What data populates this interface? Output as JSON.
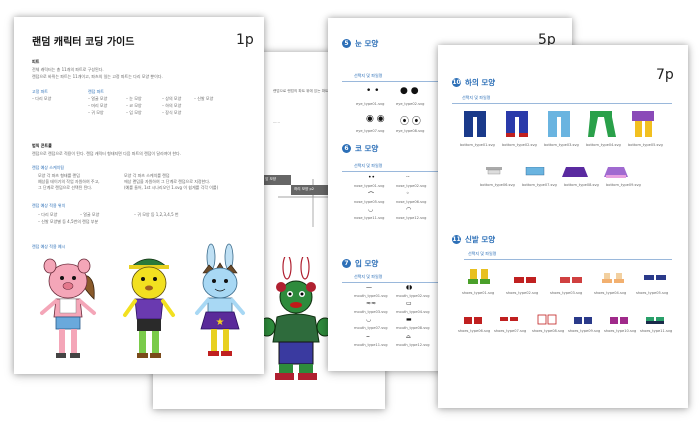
{
  "page1": {
    "title": "랜덤 캐릭터 코딩 가이드",
    "num": "1p",
    "sec1": "피트",
    "sec1_text1": "전체 캐릭터는 총 11개의 파트로 구성된다.",
    "sec1_text2": "랜덤으로 바뀌는 파트는 11개이고, 파츠의 일는 고정 파트는 다리 모양 뿐이다.",
    "list_a": "고정 파트",
    "list_a1": "– 다리 모양",
    "list_b": "랜덤 파트",
    "list_b_items": [
      "– 얼굴 모양",
      "– 눈 모양",
      "– 상의 모양",
      "– 신발 모양",
      "– 머리 모양",
      "– 코 모양",
      "– 하의 모양",
      "– 귀 모양",
      "– 입 모양",
      "– 장식 모양"
    ],
    "sec2": "법칙 콘트롤",
    "sec2_text": "랜덤으로 랜덤으로 적용이 된다. 랜덤 캐릭터 형태지면 다음 파트의 랜덤이 달라져야 한다.",
    "sub1": "랜덤 예상 스케치됨",
    "sub1_l1": "모양 각 파츠 형태를 랜덤",
    "sub1_l2": "예상을 테이기의 작업 자원하여 주고,",
    "sub1_l3": "그 단계로 랜덤으로 선택된 된다.",
    "sub1_r1": "모양 각 파츠 스케치를 랜덤",
    "sub1_r2": "에상 랜덤을 자원하여 그 단계로 랜덤으로 지정한다.",
    "sub1_r3": "(예를 들어, 1st 시나리오인 1.svg 이 쉽게를 각각 이를)",
    "sub2": "랜덤 예상 적용 위치",
    "sub2_row1": [
      "– 다리 모양",
      "– 얼굴 모양",
      "– 귀 모양 등 1,2,3,4,5 번"
    ],
    "sub2_row2": "– 신발 모양별 등 4,5번의 랜덤 부분",
    "sub3": "랜덤 예상 적용 예시"
  },
  "page_mid": {
    "labels": [
      "앞 모양",
      "하리 모양",
      "하리 모양 p2"
    ],
    "text": "랜덤으로 랜덤의 파트 위에 있는 파트"
  },
  "page5": {
    "num": "5p",
    "s5": "눈 모양",
    "s5_badge": "5",
    "s6": "코 모양",
    "s6_badge": "6",
    "s7": "입 모양",
    "s7_badge": "7",
    "sub": "선택지 및 파일명",
    "eyes": [
      "eye_type01.svg",
      "eye_type02.svg",
      "eye_type05.svg",
      "eye_type06.svg",
      "eye_type07.svg",
      "eye_type08.svg"
    ],
    "nose": [
      "nose_type01.svg",
      "nose_type02.svg",
      "nose_type05.svg",
      "nose_type06.svg",
      "nose_type11.svg",
      "nose_type12.svg"
    ],
    "mouth": [
      "mouth_type01.svg",
      "mouth_type02.svg",
      "mouth_type03.svg",
      "mouth_type04.svg",
      "mouth_type07.svg",
      "mouth_type08.svg",
      "mouth_type11.svg",
      "mouth_type12.svg"
    ]
  },
  "page7": {
    "num": "7p",
    "s10": "하의 모양",
    "s10_badge": "10",
    "s11": "신발 모양",
    "s11_badge": "11",
    "sub": "선택지 및 파일명",
    "bottoms1": [
      "bottom_type01.svg",
      "bottom_type02.svg",
      "bottom_type03.svg",
      "bottom_type04.svg",
      "bottom_type05.svg"
    ],
    "bottoms2": [
      "bottom_type06.svg",
      "bottom_type07.svg",
      "bottom_type08.svg",
      "bottom_type09.svg"
    ],
    "shoes1": [
      "shoes_type01.svg",
      "shoes_type02.svg",
      "shoes_type03.svg",
      "shoes_type04.svg",
      "shoes_type05.svg"
    ],
    "shoes2": [
      "shoes_type06.svg",
      "shoes_type07.svg",
      "shoes_type08.svg",
      "shoes_type09.svg",
      "shoes_type10.svg",
      "shoes_type11.svg"
    ]
  },
  "colors": {
    "accent": "#2c6fb7"
  }
}
